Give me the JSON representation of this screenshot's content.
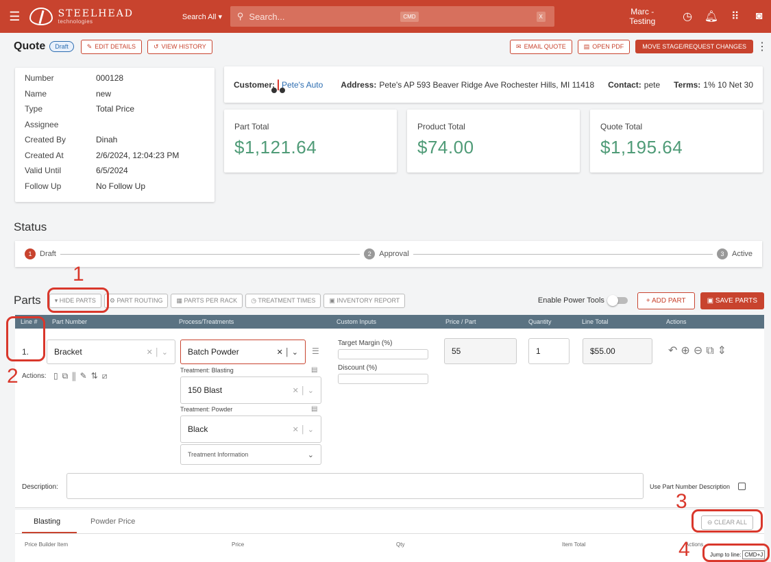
{
  "topbar": {
    "brand": "STEELHEAD",
    "brand_sub": "technologies",
    "search_scope": "Search All ▾",
    "search_placeholder": "Search...",
    "kbd_cmd": "CMD",
    "kbd_x": "X",
    "user_line1": "Marc -",
    "user_line2": "Testing"
  },
  "quote": {
    "title": "Quote",
    "status_badge": "Draft",
    "edit_details": "EDIT DETAILS",
    "view_history": "VIEW HISTORY",
    "email_quote": "EMAIL QUOTE",
    "open_pdf": "OPEN PDF",
    "move_stage": "MOVE STAGE/REQUEST CHANGES"
  },
  "details": {
    "rows": [
      {
        "k": "Number",
        "v": "000128"
      },
      {
        "k": "Name",
        "v": "new"
      },
      {
        "k": "Type",
        "v": "Total Price"
      },
      {
        "k": "Assignee",
        "v": ""
      },
      {
        "k": "Created By",
        "v": "Dinah"
      },
      {
        "k": "Created At",
        "v": "2/6/2024, 12:04:23 PM"
      },
      {
        "k": "Valid Until",
        "v": "6/5/2024"
      },
      {
        "k": "Follow Up",
        "v": "No Follow Up"
      }
    ]
  },
  "customer": {
    "customer_label": "Customer:",
    "customer_name": "Pete's Auto",
    "address_label": "Address:",
    "address": "Pete's AP 593 Beaver Ridge Ave Rochester Hills, MI 11418",
    "contact_label": "Contact:",
    "contact": "pete",
    "terms_label": "Terms:",
    "terms": "1% 10 Net 30"
  },
  "totals": {
    "part_label": "Part Total",
    "part_value": "$1,121.64",
    "product_label": "Product Total",
    "product_value": "$74.00",
    "quote_label": "Quote Total",
    "quote_value": "$1,195.64"
  },
  "status": {
    "title": "Status",
    "steps": [
      {
        "num": "1",
        "label": "Draft"
      },
      {
        "num": "2",
        "label": "Approval"
      },
      {
        "num": "3",
        "label": "Active"
      }
    ]
  },
  "parts": {
    "title": "Parts",
    "hide_parts": "▾ HIDE PARTS",
    "part_routing": "PART ROUTING",
    "parts_per_rack": "PARTS PER RACK",
    "treatment_times": "TREATMENT TIMES",
    "inventory_report": "INVENTORY REPORT",
    "power_tools_label": "Enable Power Tools",
    "add_part": "+ ADD PART",
    "save_parts": "SAVE PARTS",
    "columns": [
      "Line #",
      "Part Number",
      "Process/Treatments",
      "Custom Inputs",
      "Price / Part",
      "Quantity",
      "Line Total",
      "Actions"
    ],
    "line_no": "1.",
    "part_number": "Bracket",
    "actions_label": "Actions:",
    "process": "Batch Powder",
    "treatment_blasting_label": "Treatment: Blasting",
    "treatment_blasting_value": "150 Blast",
    "treatment_powder_label": "Treatment: Powder",
    "treatment_powder_value": "Black",
    "treatment_info": "Treatment Information",
    "target_margin_label": "Target Margin (%)",
    "discount_label": "Discount (%)",
    "price_per_part": "55",
    "quantity": "1",
    "line_total": "$55.00",
    "description_label": "Description:",
    "use_part_desc": "Use Part Number Description"
  },
  "price_builder": {
    "tab_blasting": "Blasting",
    "tab_powder": "Powder Price",
    "clear_all": "CLEAR ALL",
    "columns": [
      "Price Builder Item",
      "Price",
      "Qty",
      "Item Total",
      "Actions"
    ],
    "jump_label": "Jump to line:",
    "jump_kbd": "CMD+J"
  },
  "annotations": [
    "1",
    "2",
    "3",
    "4"
  ],
  "colors": {
    "brand": "#c8432e",
    "money": "#4f9b77",
    "link": "#2b6cb0",
    "header": "#5a7282",
    "annotation": "#d9372b"
  }
}
